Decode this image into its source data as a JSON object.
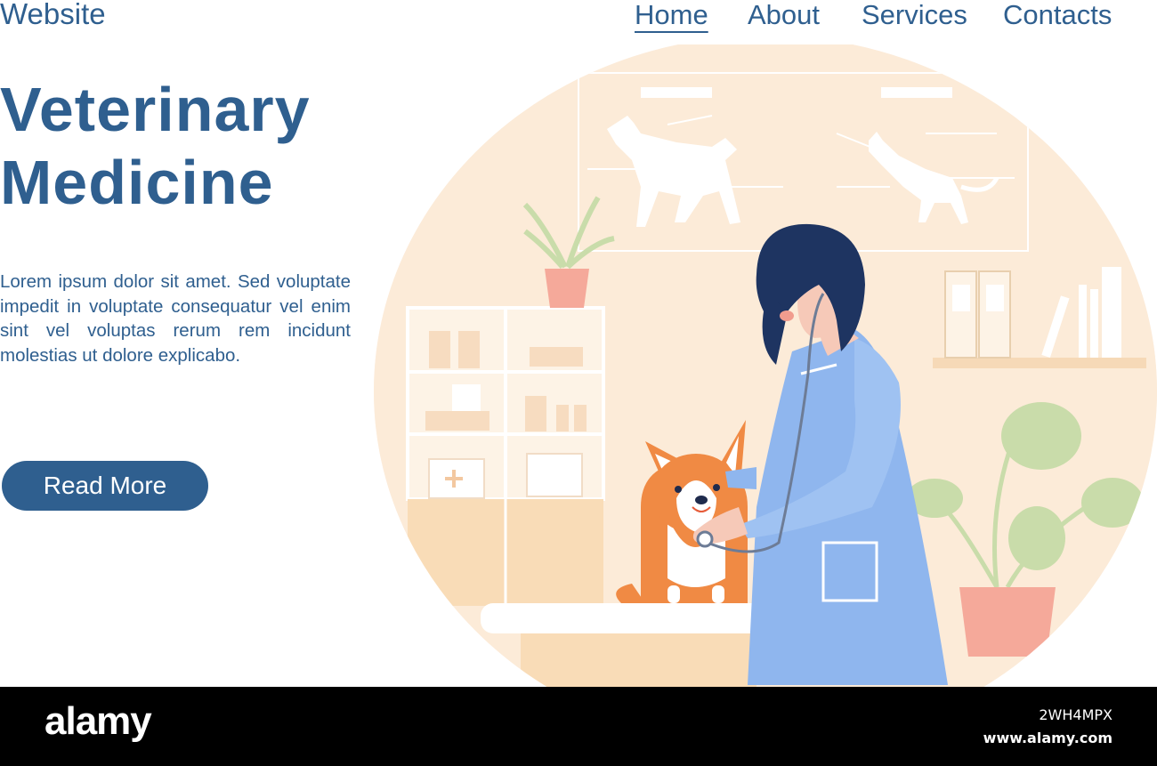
{
  "site": {
    "logo": "Website"
  },
  "nav": {
    "items": [
      {
        "label": "Home",
        "active": true
      },
      {
        "label": "About",
        "active": false
      },
      {
        "label": "Services",
        "active": false
      },
      {
        "label": "Contacts",
        "active": false
      }
    ]
  },
  "hero": {
    "title_line1": "Veterinary",
    "title_line2": "Medicine",
    "body": "Lorem ipsum dolor sit amet. Sed voluptate impedit in voluptate conse­quatur vel enim sint vel voluptas rerum rem incidunt molestias ut dolore explicabo.",
    "cta_label": "Read More"
  },
  "watermark": {
    "brand": "alamy",
    "image_id": "2WH4MPX",
    "url": "www.alamy.com"
  },
  "colors": {
    "primary": "#2f5f8f",
    "background": "#ffffff",
    "illustration_bg": "#fbe8d3",
    "coat": "#8fb6ee",
    "corgi": "#f08a44",
    "plant": "#c9dcaa",
    "pot": "#f5a99a"
  }
}
